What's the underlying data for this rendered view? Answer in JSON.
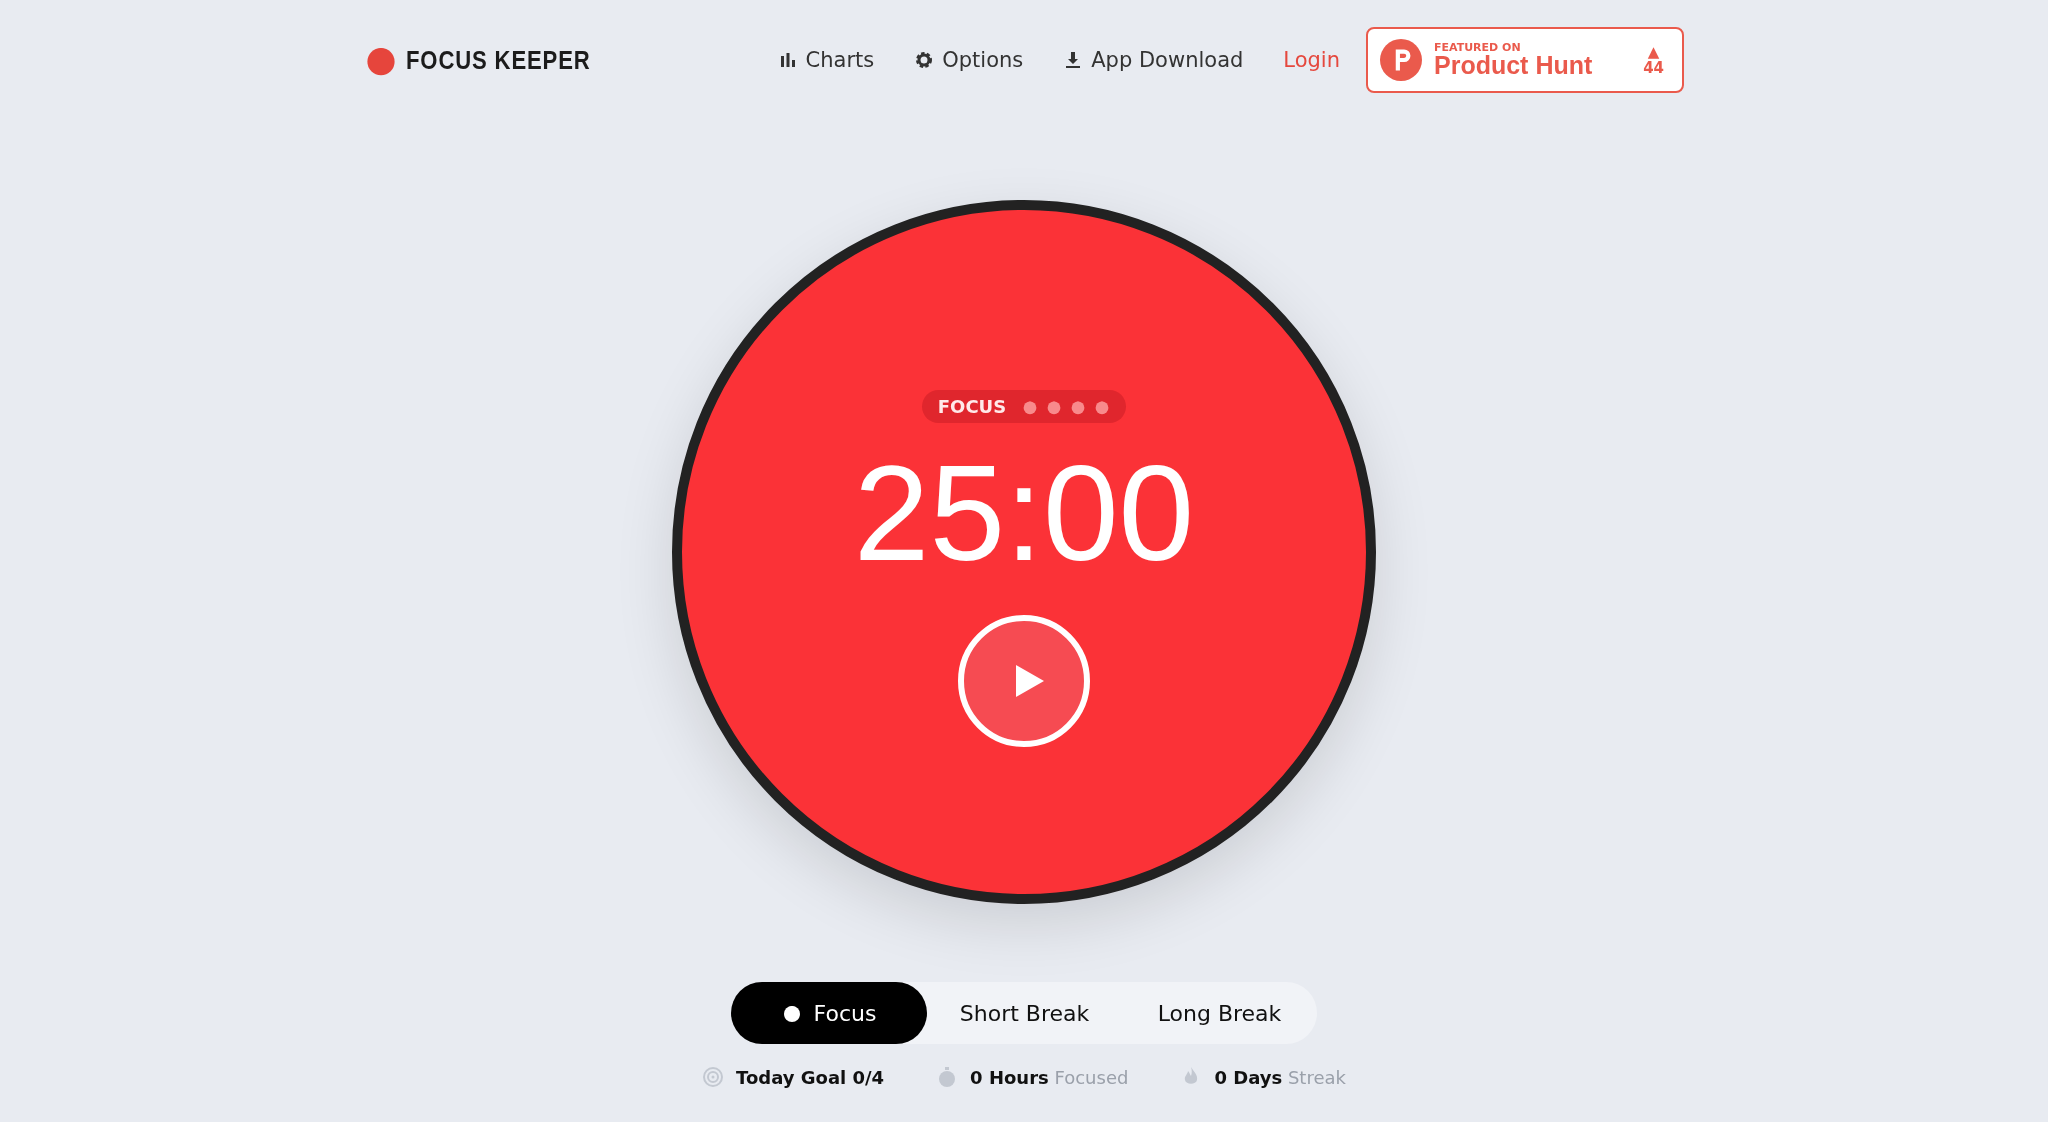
{
  "logo": {
    "text": "FOCUS KEEPER"
  },
  "nav": [
    {
      "label": "Charts",
      "kind": "chart"
    },
    {
      "label": "Options",
      "kind": "gear"
    },
    {
      "label": "App Download",
      "kind": "download"
    },
    {
      "label": "Login",
      "kind": "login"
    }
  ],
  "product_hunt": {
    "caption": "FEATURED ON",
    "name": "Product Hunt",
    "votes": "44",
    "arrow": "▲"
  },
  "timer": {
    "mode": "FOCUS",
    "sessions": [
      {
        "done": false
      },
      {
        "done": false
      },
      {
        "done": false
      },
      {
        "done": false
      }
    ],
    "time": "25:00"
  },
  "tabs": [
    {
      "label": "Focus",
      "selected": true
    },
    {
      "label": "Short Break",
      "selected": false
    },
    {
      "label": "Long Break",
      "selected": false
    }
  ],
  "stats": [
    {
      "kind": "goal",
      "value": "Today Goal 0/4"
    },
    {
      "kind": "hours",
      "value": "0 Hours",
      "label": "Focused"
    },
    {
      "kind": "streak",
      "value": "0 Days",
      "label": "Streak"
    }
  ]
}
